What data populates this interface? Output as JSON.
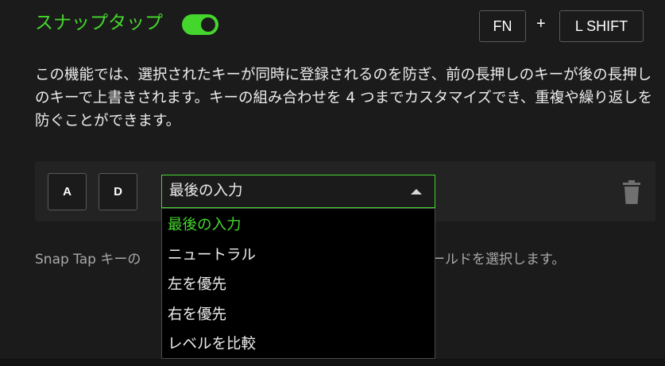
{
  "header": {
    "title": "スナップタップ",
    "toggle_on": true,
    "shortcut": {
      "key1": "FN",
      "separator": "+",
      "key2": "L SHIFT"
    }
  },
  "description": "この機能では、選択されたキーが同時に登録されるのを防ぎ、前の長押しのキーが後の長押しのキーで上書きされます。キーの組み合わせを 4 つまでカスタマイズでき、重複や繰り返しを防ぐことができます。",
  "combo": {
    "key_a": "A",
    "key_d": "D",
    "selected": "最後の入力",
    "options": [
      "最後の入力",
      "ニュートラル",
      "左を優先",
      "右を優先",
      "レベルを比較"
    ],
    "delete_icon": "trash-icon"
  },
  "hint_visible_start": "Snap Tap キーの",
  "hint_visible_end": "カフィールドを選択します。",
  "colors": {
    "accent": "#44d62c",
    "background": "#1b1b1b",
    "dropdown_bg": "#000000"
  }
}
